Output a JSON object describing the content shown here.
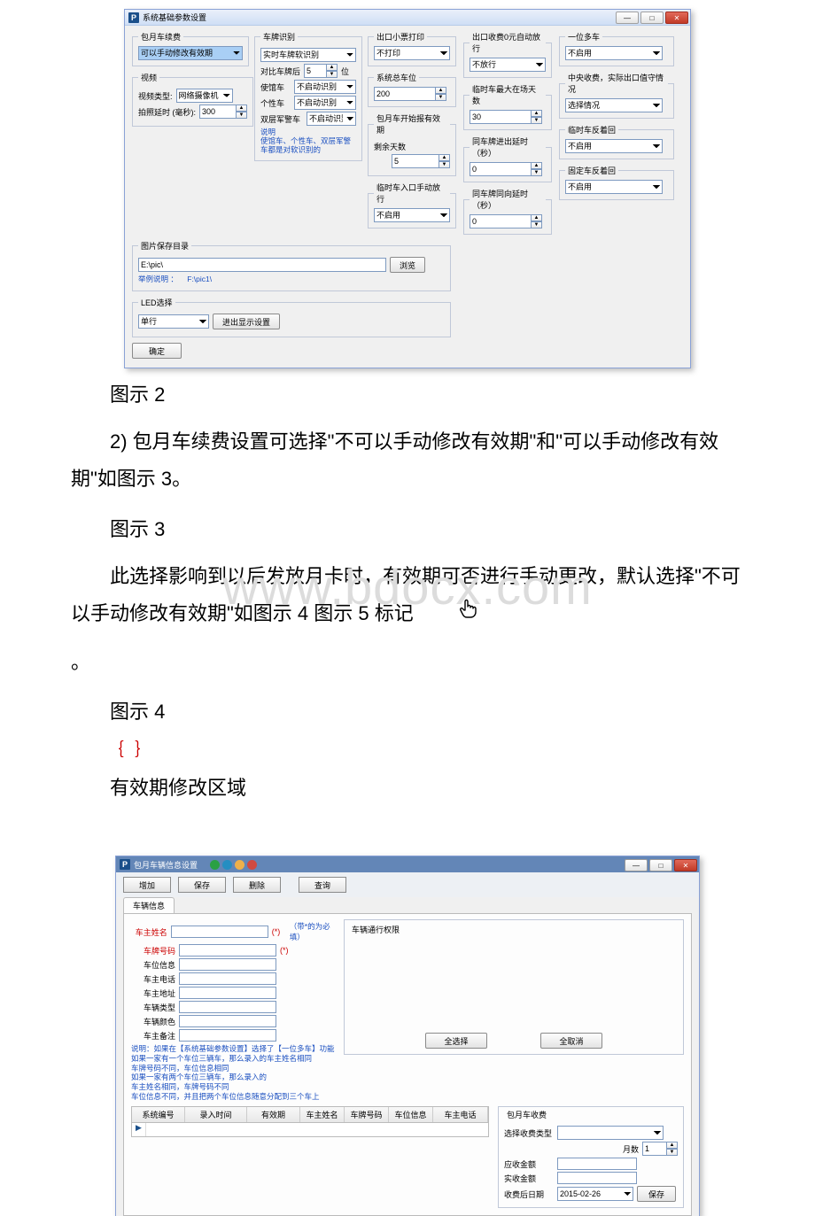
{
  "watermark": "www.bdocx.com",
  "doc": {
    "caption2": "图示 2",
    "para1": "2) 包月车续费设置可选择\"不可以手动修改有效期\"和\"可以手动修改有效期\"如图示 3。",
    "caption3": "图示 3",
    "para2a": "此选择影响到以后发放月卡时，有效期可否进行手动更改，默认选择\"不可以手动修改有效期\"如图示 4 图示 5 标记 ",
    "para2b": "。",
    "caption4": "图示 4",
    "bracket": "｛                    ｝",
    "validarea": "有效期修改区域"
  },
  "dlg1": {
    "title": "系统基础参数设置",
    "group_monthly": "包月车续费",
    "monthly_select": "可以手动修改有效期",
    "group_video": "视频",
    "video_type_label": "视频类型:",
    "video_type_value": "网络摄像机",
    "capture_delay_label": "拍照延时 (毫秒):",
    "capture_delay_value": "300",
    "group_plate": "车牌识别",
    "plate_mode": "实时车牌软识别",
    "plate_compare_label": "对比车牌后",
    "plate_compare_value": "5",
    "plate_compare_unit": "位",
    "plate_inspect_label": "使馆车",
    "plate_inspect_value": "不启动识别",
    "plate_personal_label": "个性车",
    "plate_personal_value": "不启动识别",
    "plate_military_label": "双层军警车",
    "plate_military_value": "不启动识别",
    "plate_note_title": "说明",
    "plate_note_body": "使馆车、个性车、双层军警车都是对软识别的",
    "group_ticket": "出口小票打印",
    "ticket_value": "不打印",
    "group_total": "系统总车位",
    "total_value": "200",
    "group_prealert": "包月车开始报有效期",
    "prealert_label": "剩余天数",
    "prealert_value": "5",
    "group_manual_in": "临时车入口手动放行",
    "manual_in_value": "不启用",
    "group_zero_fee": "出口收费0元自动放行",
    "zero_fee_value": "不放行",
    "group_max_days": "临时车最大在场天数",
    "max_days_value": "30",
    "group_inout_delay": "同车牌进出延时（秒）",
    "inout_delay_value": "0",
    "group_same_delay": "同车牌同向延时（秒）",
    "same_delay_value": "0",
    "group_multi_car": "一位多车",
    "multi_car_value": "不启用",
    "group_central_fee": "中央收费，实际出口值守情况",
    "central_fee_value": "选择情况",
    "group_temp_loop": "临时车反着回",
    "temp_loop_value": "不启用",
    "group_fixed_loop": "固定车反着回",
    "fixed_loop_value": "不启用",
    "group_pic_path": "图片保存目录",
    "pic_path_value": "E:\\pic\\",
    "browse_btn": "浏览",
    "pic_example_label": "举例说明 ：",
    "pic_example_value": "F:\\pic1\\",
    "group_led": "LED选择",
    "led_value": "单行",
    "led_btn": "进出显示设置",
    "ok_btn": "确定"
  },
  "dlg2": {
    "title": "包月车辆信息设置",
    "btn_add": "增加",
    "btn_save": "保存",
    "btn_delete": "删除",
    "btn_query": "查询",
    "tab_label": "车辆信息",
    "owner_name_label": "车主姓名",
    "plate_label": "车牌号码",
    "slot_label": "车位信息",
    "phone_label": "车主电话",
    "addr_label": "车主地址",
    "car_type_label": "车辆类型",
    "car_color_label": "车辆颜色",
    "remark_label": "车主备注",
    "star": "(*)",
    "star_note": "（带*的为必填）",
    "note_line1": "说明：如果在【系统基础参数设置】选择了【一位多车】功能",
    "note_line2": "如果一家有一个车位三辆车，那么录入的车主姓名相同",
    "note_line3": "车牌号码不同，车位信息相同",
    "note_line4": "如果一家有两个车位三辆车，那么录入的",
    "note_line5": "车主姓名相同，车牌号码不同",
    "note_line6": "车位信息不同，并且把两个车位信息随意分配到三个车上",
    "perm_title": "车辆通行权限",
    "select_all": "全选择",
    "select_none": "全取消",
    "th1": "系统编号",
    "th2": "录入时间",
    "th3": "有效期",
    "th4": "车主姓名",
    "th5": "车牌号码",
    "th6": "车位信息",
    "th7": "车主电话",
    "fee_title": "包月车收费",
    "fee_type_label": "选择收费类型",
    "months_label": "月数",
    "months_value": "1",
    "due_label": "应收金额",
    "paid_label": "实收金额",
    "fee_date_label": "收费后日期",
    "fee_date_value": "2015-02-26",
    "save_btn": "保存"
  }
}
